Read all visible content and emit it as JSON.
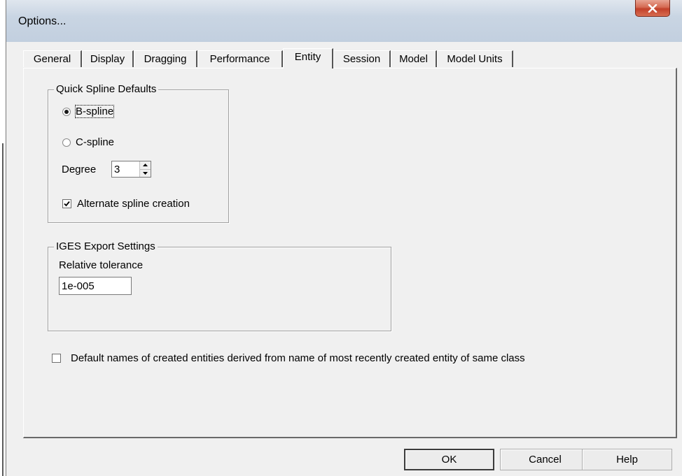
{
  "window": {
    "title": "Options...",
    "close_icon": "close-icon",
    "close_color": "#c94a33"
  },
  "tabs": [
    {
      "label": "General",
      "active": false
    },
    {
      "label": "Display",
      "active": false
    },
    {
      "label": "Dragging",
      "active": false
    },
    {
      "label": "Performance",
      "active": false
    },
    {
      "label": "Entity",
      "active": true
    },
    {
      "label": "Session",
      "active": false
    },
    {
      "label": "Model",
      "active": false
    },
    {
      "label": "Model Units",
      "active": false
    }
  ],
  "quick_spline": {
    "legend": "Quick Spline Defaults",
    "bspline_label": "B-spline",
    "bspline_selected": true,
    "cspline_label": "C-spline",
    "cspline_selected": false,
    "degree_label": "Degree",
    "degree_value": "3",
    "alternate_label": "Alternate spline creation",
    "alternate_checked": true
  },
  "iges": {
    "legend": "IGES Export Settings",
    "tolerance_label": "Relative tolerance",
    "tolerance_value": "1e-005"
  },
  "default_names": {
    "label": "Default names of created entities derived from name of most recently created entity of same class",
    "checked": false
  },
  "buttons": {
    "ok": "OK",
    "cancel": "Cancel",
    "help": "Help"
  }
}
